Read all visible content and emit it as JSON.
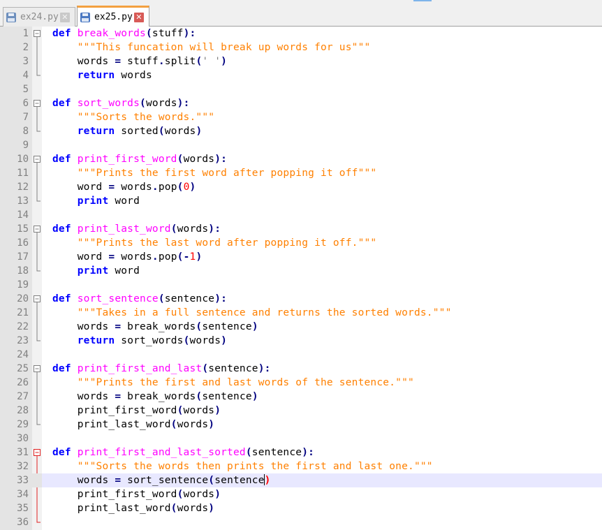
{
  "tabs": [
    {
      "label": "ex24.py",
      "active": false
    },
    {
      "label": "ex25.py",
      "active": true
    }
  ],
  "editor": {
    "current_line": 33,
    "fold_red_block": [
      31,
      36
    ],
    "lines": [
      {
        "n": "1",
        "fold": "start",
        "tokens": [
          [
            "kw",
            "def"
          ],
          [
            "pl",
            " "
          ],
          [
            "fn",
            "break_words"
          ],
          [
            "op",
            "("
          ],
          [
            "pl",
            "stuff"
          ],
          [
            "op",
            ")"
          ],
          [
            "op",
            ":"
          ]
        ]
      },
      {
        "n": "2",
        "fold": "mid",
        "tokens": [
          [
            "pl",
            "    "
          ],
          [
            "doc",
            "\"\"\"This funcation will break up words for us\"\"\""
          ]
        ]
      },
      {
        "n": "3",
        "fold": "mid",
        "tokens": [
          [
            "pl",
            "    words "
          ],
          [
            "op",
            "="
          ],
          [
            "pl",
            " stuff"
          ],
          [
            "op",
            "."
          ],
          [
            "pl",
            "split"
          ],
          [
            "op",
            "("
          ],
          [
            "str",
            "' '"
          ],
          [
            "op",
            ")"
          ]
        ]
      },
      {
        "n": "4",
        "fold": "end",
        "tokens": [
          [
            "pl",
            "    "
          ],
          [
            "kw",
            "return"
          ],
          [
            "pl",
            " words"
          ]
        ]
      },
      {
        "n": "5",
        "fold": "none",
        "tokens": []
      },
      {
        "n": "6",
        "fold": "start",
        "tokens": [
          [
            "kw",
            "def"
          ],
          [
            "pl",
            " "
          ],
          [
            "fn",
            "sort_words"
          ],
          [
            "op",
            "("
          ],
          [
            "pl",
            "words"
          ],
          [
            "op",
            ")"
          ],
          [
            "op",
            ":"
          ]
        ]
      },
      {
        "n": "7",
        "fold": "mid",
        "tokens": [
          [
            "pl",
            "    "
          ],
          [
            "doc",
            "\"\"\"Sorts the words.\"\"\""
          ]
        ]
      },
      {
        "n": "8",
        "fold": "end",
        "tokens": [
          [
            "pl",
            "    "
          ],
          [
            "kw",
            "return"
          ],
          [
            "pl",
            " sorted"
          ],
          [
            "op",
            "("
          ],
          [
            "pl",
            "words"
          ],
          [
            "op",
            ")"
          ]
        ]
      },
      {
        "n": "9",
        "fold": "none",
        "tokens": []
      },
      {
        "n": "10",
        "fold": "start",
        "tokens": [
          [
            "kw",
            "def"
          ],
          [
            "pl",
            " "
          ],
          [
            "fn",
            "print_first_word"
          ],
          [
            "op",
            "("
          ],
          [
            "pl",
            "words"
          ],
          [
            "op",
            ")"
          ],
          [
            "op",
            ":"
          ]
        ]
      },
      {
        "n": "11",
        "fold": "mid",
        "tokens": [
          [
            "pl",
            "    "
          ],
          [
            "doc",
            "\"\"\"Prints the first word after popping it off\"\"\""
          ]
        ]
      },
      {
        "n": "12",
        "fold": "mid",
        "tokens": [
          [
            "pl",
            "    word "
          ],
          [
            "op",
            "="
          ],
          [
            "pl",
            " words"
          ],
          [
            "op",
            "."
          ],
          [
            "pl",
            "pop"
          ],
          [
            "op",
            "("
          ],
          [
            "num",
            "0"
          ],
          [
            "op",
            ")"
          ]
        ]
      },
      {
        "n": "13",
        "fold": "end",
        "tokens": [
          [
            "pl",
            "    "
          ],
          [
            "kw",
            "print"
          ],
          [
            "pl",
            " word"
          ]
        ]
      },
      {
        "n": "14",
        "fold": "none",
        "tokens": []
      },
      {
        "n": "15",
        "fold": "start",
        "tokens": [
          [
            "kw",
            "def"
          ],
          [
            "pl",
            " "
          ],
          [
            "fn",
            "print_last_word"
          ],
          [
            "op",
            "("
          ],
          [
            "pl",
            "words"
          ],
          [
            "op",
            ")"
          ],
          [
            "op",
            ":"
          ]
        ]
      },
      {
        "n": "16",
        "fold": "mid",
        "tokens": [
          [
            "pl",
            "    "
          ],
          [
            "doc",
            "\"\"\"Prints the last word after popping it off.\"\"\""
          ]
        ]
      },
      {
        "n": "17",
        "fold": "mid",
        "tokens": [
          [
            "pl",
            "    word "
          ],
          [
            "op",
            "="
          ],
          [
            "pl",
            " words"
          ],
          [
            "op",
            "."
          ],
          [
            "pl",
            "pop"
          ],
          [
            "op",
            "("
          ],
          [
            "op",
            "-"
          ],
          [
            "num",
            "1"
          ],
          [
            "op",
            ")"
          ]
        ]
      },
      {
        "n": "18",
        "fold": "end",
        "tokens": [
          [
            "pl",
            "    "
          ],
          [
            "kw",
            "print"
          ],
          [
            "pl",
            " word"
          ]
        ]
      },
      {
        "n": "19",
        "fold": "none",
        "tokens": []
      },
      {
        "n": "20",
        "fold": "start",
        "tokens": [
          [
            "kw",
            "def"
          ],
          [
            "pl",
            " "
          ],
          [
            "fn",
            "sort_sentence"
          ],
          [
            "op",
            "("
          ],
          [
            "pl",
            "sentence"
          ],
          [
            "op",
            ")"
          ],
          [
            "op",
            ":"
          ]
        ]
      },
      {
        "n": "21",
        "fold": "mid",
        "tokens": [
          [
            "pl",
            "    "
          ],
          [
            "doc",
            "\"\"\"Takes in a full sentence and returns the sorted words.\"\"\""
          ]
        ]
      },
      {
        "n": "22",
        "fold": "mid",
        "tokens": [
          [
            "pl",
            "    words "
          ],
          [
            "op",
            "="
          ],
          [
            "pl",
            " break_words"
          ],
          [
            "op",
            "("
          ],
          [
            "pl",
            "sentence"
          ],
          [
            "op",
            ")"
          ]
        ]
      },
      {
        "n": "23",
        "fold": "end",
        "tokens": [
          [
            "pl",
            "    "
          ],
          [
            "kw",
            "return"
          ],
          [
            "pl",
            " sort_words"
          ],
          [
            "op",
            "("
          ],
          [
            "pl",
            "words"
          ],
          [
            "op",
            ")"
          ]
        ]
      },
      {
        "n": "24",
        "fold": "none",
        "tokens": []
      },
      {
        "n": "25",
        "fold": "start",
        "tokens": [
          [
            "kw",
            "def"
          ],
          [
            "pl",
            " "
          ],
          [
            "fn",
            "print_first_and_last"
          ],
          [
            "op",
            "("
          ],
          [
            "pl",
            "sentence"
          ],
          [
            "op",
            ")"
          ],
          [
            "op",
            ":"
          ]
        ]
      },
      {
        "n": "26",
        "fold": "mid",
        "tokens": [
          [
            "pl",
            "    "
          ],
          [
            "doc",
            "\"\"\"Prints the first and last words of the sentence.\"\"\""
          ]
        ]
      },
      {
        "n": "27",
        "fold": "mid",
        "tokens": [
          [
            "pl",
            "    words "
          ],
          [
            "op",
            "="
          ],
          [
            "pl",
            " break_words"
          ],
          [
            "op",
            "("
          ],
          [
            "pl",
            "sentence"
          ],
          [
            "op",
            ")"
          ]
        ]
      },
      {
        "n": "28",
        "fold": "mid",
        "tokens": [
          [
            "pl",
            "    print_first_word"
          ],
          [
            "op",
            "("
          ],
          [
            "pl",
            "words"
          ],
          [
            "op",
            ")"
          ]
        ]
      },
      {
        "n": "29",
        "fold": "end",
        "tokens": [
          [
            "pl",
            "    print_last_word"
          ],
          [
            "op",
            "("
          ],
          [
            "pl",
            "words"
          ],
          [
            "op",
            ")"
          ]
        ]
      },
      {
        "n": "30",
        "fold": "none",
        "tokens": []
      },
      {
        "n": "31",
        "fold": "start",
        "tokens": [
          [
            "kw",
            "def"
          ],
          [
            "pl",
            " "
          ],
          [
            "fn",
            "print_first_and_last_sorted"
          ],
          [
            "op",
            "("
          ],
          [
            "pl",
            "sentence"
          ],
          [
            "op",
            ")"
          ],
          [
            "op",
            ":"
          ]
        ]
      },
      {
        "n": "32",
        "fold": "mid",
        "tokens": [
          [
            "pl",
            "    "
          ],
          [
            "doc",
            "\"\"\"Sorts the words then prints the first and last one.\"\"\""
          ]
        ]
      },
      {
        "n": "33",
        "fold": "mid",
        "tokens": [
          [
            "pl",
            "    words "
          ],
          [
            "op",
            "="
          ],
          [
            "pl",
            " sort_sentence"
          ],
          [
            "op",
            "("
          ],
          [
            "pl",
            "sentence"
          ],
          [
            "caret",
            ""
          ],
          [
            "brace-hl",
            ")"
          ]
        ]
      },
      {
        "n": "34",
        "fold": "mid",
        "tokens": [
          [
            "pl",
            "    print_first_word"
          ],
          [
            "op",
            "("
          ],
          [
            "pl",
            "words"
          ],
          [
            "op",
            ")"
          ]
        ]
      },
      {
        "n": "35",
        "fold": "mid",
        "tokens": [
          [
            "pl",
            "    print_last_word"
          ],
          [
            "op",
            "("
          ],
          [
            "pl",
            "words"
          ],
          [
            "op",
            ")"
          ]
        ]
      },
      {
        "n": "36",
        "fold": "end",
        "tokens": []
      }
    ]
  },
  "colors": {
    "keyword": "#0000ff",
    "function_name": "#ff00ff",
    "docstring": "#ff8000",
    "string": "#808080",
    "number": "#ff0000",
    "operator": "#000080",
    "current_line_bg": "#e8e8ff",
    "gutter_bg": "#e4e4e4",
    "active_tab_accent": "#f3a040"
  }
}
